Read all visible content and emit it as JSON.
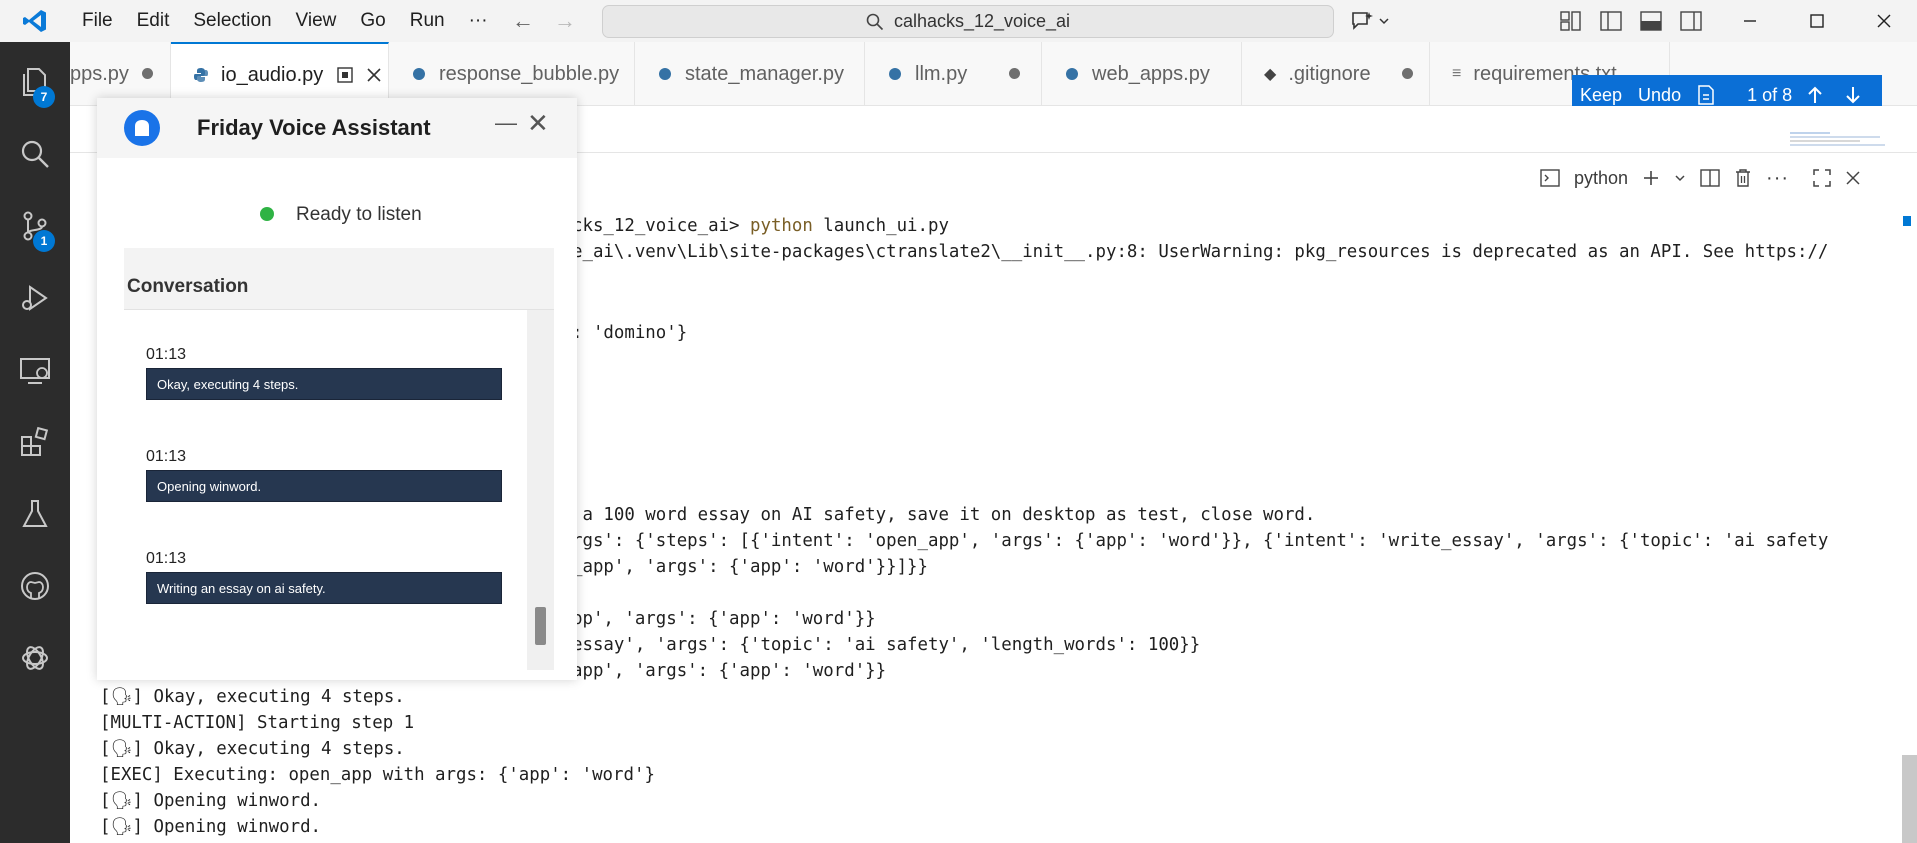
{
  "menu": {
    "items": [
      "File",
      "Edit",
      "Selection",
      "View",
      "Go",
      "Run",
      "···"
    ]
  },
  "search": {
    "text": "calhacks_12_voice_ai"
  },
  "activity": {
    "explorer_badge": "7",
    "scm_badge": "1"
  },
  "tabs": [
    {
      "label": "pps.py",
      "modified": true
    },
    {
      "label": "io_audio.py",
      "modified": false,
      "active": true
    },
    {
      "label": "response_bubble.py",
      "modified": false
    },
    {
      "label": "state_manager.py",
      "modified": false
    },
    {
      "label": "llm.py",
      "modified": true
    },
    {
      "label": "web_apps.py",
      "modified": false
    },
    {
      "label": ".gitignore",
      "modified": true
    },
    {
      "label": "requirements.txt",
      "modified": true
    }
  ],
  "keep_bar": {
    "keep": "Keep",
    "undo": "Undo",
    "counter": "1 of 8"
  },
  "terminal": {
    "shell_label": "python",
    "lines": [
      {
        "text": "cks_12_voice_ai> ",
        "cmd": "python",
        "rest": " launch_ui.py"
      },
      {
        "text": "e_ai\\.venv\\Lib\\site-packages\\ctranslate2\\__init__.py:8: UserWarning: pkg_resources is deprecated as an API. See https://"
      },
      {
        "text": ": 'domino'}"
      },
      {
        "text": " a 100 word essay on AI safety, save it on desktop as test, close word."
      },
      {
        "text": "rgs': {'steps': [{'intent': 'open_app', 'args': {'app': 'word'}}, {'intent': 'write_essay', 'args': {'topic': 'ai safety"
      },
      {
        "text": "_app', 'args': {'app': 'word'}}]}}"
      },
      {
        "text": "pp', 'args': {'app': 'word'}}"
      },
      {
        "text": "essay', 'args': {'topic': 'ai safety', 'length_words': 100}}"
      },
      {
        "text": "app', 'args': {'app': 'word'}}"
      },
      {
        "text": "[🗣] Okay, executing 4 steps."
      },
      {
        "text": "[MULTI-ACTION] Starting step 1"
      },
      {
        "text": "[🗣] Okay, executing 4 steps."
      },
      {
        "text": "[EXEC] Executing: open_app with args: {'app': 'word'}"
      },
      {
        "text": "[🗣] Opening winword."
      },
      {
        "text": "[🗣] Opening winword."
      }
    ]
  },
  "friday": {
    "title": "Friday Voice Assistant",
    "status": "Ready to listen",
    "conversation_title": "Conversation",
    "messages": [
      {
        "time": "01:13",
        "text": "Okay, executing 4 steps."
      },
      {
        "time": "01:13",
        "text": "Opening winword."
      },
      {
        "time": "01:13",
        "text": "Writing an essay on ai safety."
      }
    ]
  },
  "colors": {
    "accent": "#0078d4",
    "activity_bar": "#2c2c2c",
    "bubble": "#263750",
    "status_green": "#2fb344"
  }
}
